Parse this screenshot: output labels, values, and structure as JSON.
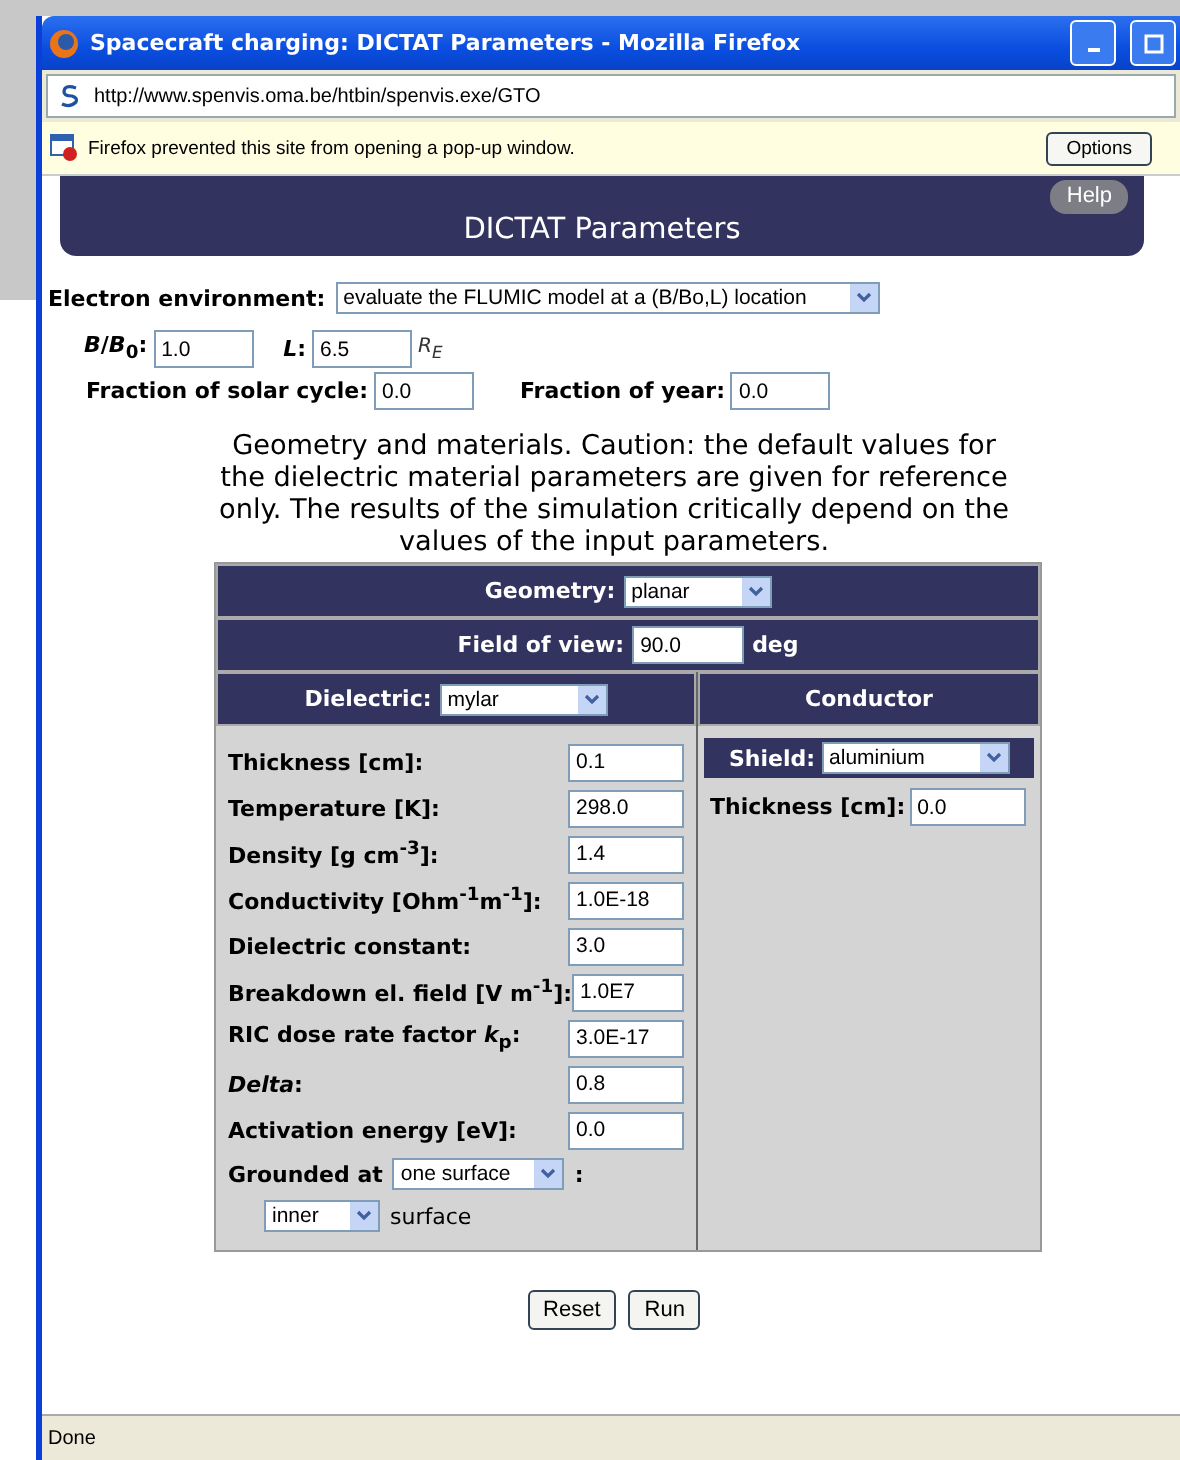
{
  "window": {
    "title": "Spacecraft charging: DICTAT Parameters - Mozilla Firefox"
  },
  "address_bar": {
    "url": "http://www.spenvis.oma.be/htbin/spenvis.exe/GTO"
  },
  "popup_notice": {
    "text": "Firefox prevented this site from opening a pop-up window.",
    "button": "Options"
  },
  "banner": {
    "subtitle": "DICTAT Parameters",
    "help_button": "Help"
  },
  "electron_environment": {
    "label": "Electron environment:",
    "value": "evaluate the FLUMIC model at a (B/Bo,L) location"
  },
  "location_fields": [
    {
      "label": "*B*/*B*$_{0}$:",
      "value": "1.0"
    },
    {
      "label": "*L*:",
      "value": "6.5",
      "unit": "*R*$_{E}$"
    }
  ],
  "cycle_fields": [
    {
      "label": "Fraction of solar cycle:",
      "value": "0.0"
    },
    {
      "label": "Fraction of year:",
      "value": "0.0"
    }
  ],
  "note": "Geometry and materials. Caution: the default values for the dielectric material parameters are given for reference only. The results of the simulation critically depend on the values of the input parameters.",
  "form_table": {
    "geometry": {
      "label": "Geometry:",
      "value": "planar"
    },
    "field_of_view": {
      "label": "Field of view:",
      "value": "90.0",
      "unit": "deg"
    },
    "dielectric": {
      "label": "Dielectric:",
      "value": "mylar"
    },
    "conductor": {
      "heading": "Conductor",
      "shield_label": "Shield:",
      "shield_value": "aluminium",
      "thickness_label": "Thickness [cm]:",
      "thickness_value": "0.0"
    },
    "dielectric_params": [
      {
        "label": "Thickness [cm]:",
        "value": "0.1"
      },
      {
        "label": "Temperature [K]:",
        "value": "298.0"
      },
      {
        "label": "Density [g cm$^{-3}$]:",
        "value": "1.4"
      },
      {
        "label": "Conductivity [Ohm$^{-1}$m$^{-1}$]:",
        "value": "1.0E-18"
      },
      {
        "label": "Dielectric constant:",
        "value": "3.0"
      },
      {
        "label": "Breakdown el. field [V m$^{-1}$]:",
        "value": "1.0E7"
      },
      {
        "label": "RIC dose rate factor *k*$_{p}$:",
        "value": "3.0E-17"
      },
      {
        "label": "*Delta*:",
        "value": "0.8"
      },
      {
        "label": "Activation energy [eV]:",
        "value": "0.0"
      }
    ],
    "grounded": {
      "label": "Grounded at",
      "value": "one surface",
      "separator": ":",
      "surface_value": "inner",
      "surface_label": "surface"
    }
  },
  "buttons": [
    "Reset",
    "Run"
  ],
  "status_bar": {
    "text": "Done"
  }
}
